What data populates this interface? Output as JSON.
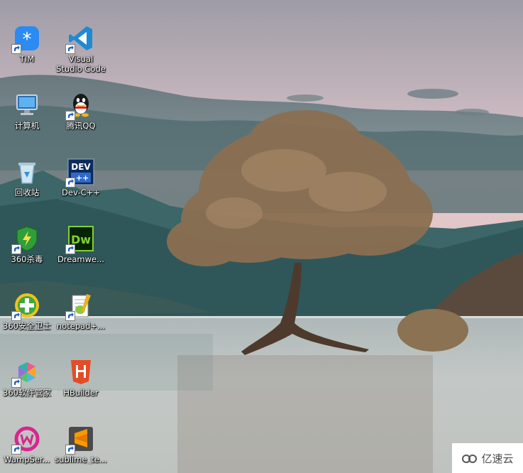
{
  "wallpaper": {
    "description_colors": {
      "sky_top": "#a9a7ad",
      "sky_pink": "#e8c5c8",
      "mountain": "#3f6e70",
      "water": "#b8c0c0",
      "tree": "#8a6e50"
    }
  },
  "desktop": {
    "icons": [
      {
        "name": "tim-icon",
        "label": "TIM"
      },
      {
        "name": "vscode-icon",
        "label": "Visual Studio Code"
      },
      {
        "name": "computer-icon",
        "label": "计算机"
      },
      {
        "name": "qq-icon",
        "label": "腾讯QQ"
      },
      {
        "name": "recycle-bin-icon",
        "label": "回收站"
      },
      {
        "name": "devcpp-icon",
        "label": "Dev-C++"
      },
      {
        "name": "360-antivirus-icon",
        "label": "360杀毒"
      },
      {
        "name": "dreamweaver-icon",
        "label": "Dreamwe..."
      },
      {
        "name": "360-safe-icon",
        "label": "360安全卫士"
      },
      {
        "name": "notepadpp-icon",
        "label": "notepad+..."
      },
      {
        "name": "360-software-icon",
        "label": "360软件管家"
      },
      {
        "name": "hbuilder-icon",
        "label": "HBuilder"
      },
      {
        "name": "wampserver-icon",
        "label": "WampSer..."
      },
      {
        "name": "sublime-icon",
        "label": "sublime_te..."
      }
    ]
  },
  "watermark": {
    "text": "亿速云"
  }
}
